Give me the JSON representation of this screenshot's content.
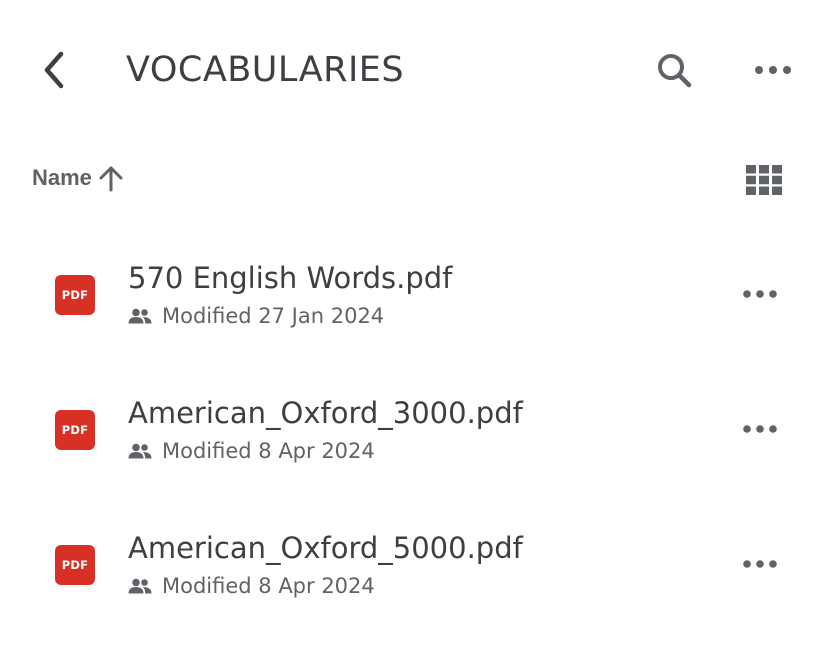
{
  "header": {
    "back_icon": "chevron-left-icon",
    "title": "VOCABULARIES",
    "search_icon": "search-icon",
    "more_icon": "more-horizontal-icon"
  },
  "sort": {
    "label": "Name",
    "direction_icon": "arrow-up-icon",
    "view_toggle_icon": "grid-view-icon"
  },
  "files": [
    {
      "icon": "pdf-icon",
      "icon_label": "PDF",
      "name": "570 English Words.pdf",
      "shared_icon": "people-icon",
      "modified": "Modified 27 Jan 2024"
    },
    {
      "icon": "pdf-icon",
      "icon_label": "PDF",
      "name": "American_Oxford_3000.pdf",
      "shared_icon": "people-icon",
      "modified": "Modified 8 Apr 2024"
    },
    {
      "icon": "pdf-icon",
      "icon_label": "PDF",
      "name": "American_Oxford_5000.pdf",
      "shared_icon": "people-icon",
      "modified": "Modified 8 Apr 2024"
    }
  ],
  "colors": {
    "text_primary": "#3c4043",
    "text_secondary": "#5f6368",
    "pdf_red": "#d93025",
    "background": "#ffffff"
  }
}
